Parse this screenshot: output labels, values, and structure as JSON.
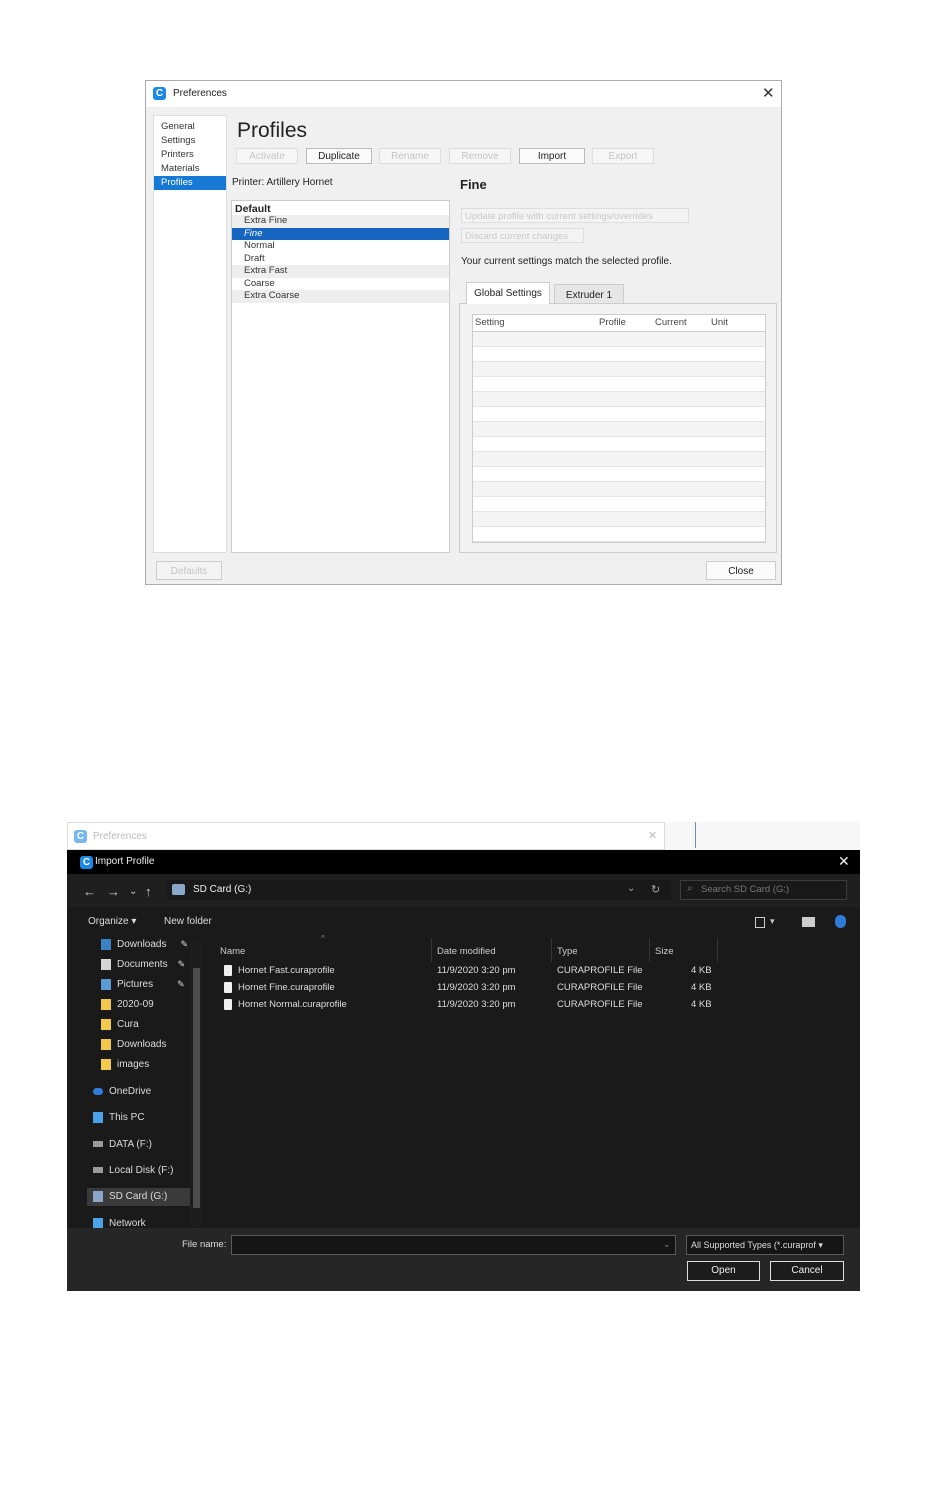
{
  "preferences": {
    "title": "Preferences",
    "close_glyph": "✕",
    "nav": [
      "General",
      "Settings",
      "Printers",
      "Materials",
      "Profiles"
    ],
    "heading": "Profiles",
    "toolbar": [
      "Activate",
      "Duplicate",
      "Rename",
      "Remove",
      "Import",
      "Export"
    ],
    "printer": "Printer: Artillery Hornet",
    "group": "Default",
    "profiles": [
      "Extra Fine",
      "Fine",
      "Normal",
      "Draft",
      "Extra Fast",
      "Coarse",
      "Extra Coarse"
    ],
    "selected_profile": "Fine",
    "detail_title": "Fine",
    "update_btn": "Update profile with current settings/overrides",
    "discard_btn": "Discard current changes",
    "match_text": "Your current settings match the selected profile.",
    "tabs": [
      "Global Settings",
      "Extruder 1"
    ],
    "columns": [
      "Setting",
      "Profile",
      "Current",
      "Unit"
    ],
    "defaults_btn": "Defaults",
    "close_btn": "Close",
    "accent": "#1779d6"
  },
  "import_dialog": {
    "background_title": "Preferences",
    "title": "Import Profile",
    "close_glyph": "✕",
    "nav_glyphs": [
      "←",
      "→",
      "⌄",
      "↑"
    ],
    "path": "SD Card (G:)",
    "search_placeholder": "Search SD Card (G:)",
    "organize": "Organize ▾",
    "new_folder": "New folder",
    "nav_items": [
      "Downloads",
      "Documents",
      "Pictures",
      "2020-09",
      "Cura",
      "Downloads",
      "images",
      "OneDrive",
      "This PC",
      "DATA (F:)",
      "Local Disk (F:)",
      "SD Card (G:)",
      "Network"
    ],
    "columns": [
      "Name",
      "Date modified",
      "Type",
      "Size"
    ],
    "files": [
      {
        "name": "Hornet Fast.curaprofile",
        "date": "11/9/2020 3:20 pm",
        "type": "CURAPROFILE File",
        "size": "4 KB"
      },
      {
        "name": "Hornet Fine.curaprofile",
        "date": "11/9/2020 3:20 pm",
        "type": "CURAPROFILE File",
        "size": "4 KB"
      },
      {
        "name": "Hornet Normal.curaprofile",
        "date": "11/9/2020 3:20 pm",
        "type": "CURAPROFILE File",
        "size": "4 KB"
      }
    ],
    "file_name_label": "File name:",
    "file_name_value": "",
    "file_type": "All Supported Types (*.curaprof ▾",
    "open_btn": "Open",
    "cancel_btn": "Cancel"
  }
}
